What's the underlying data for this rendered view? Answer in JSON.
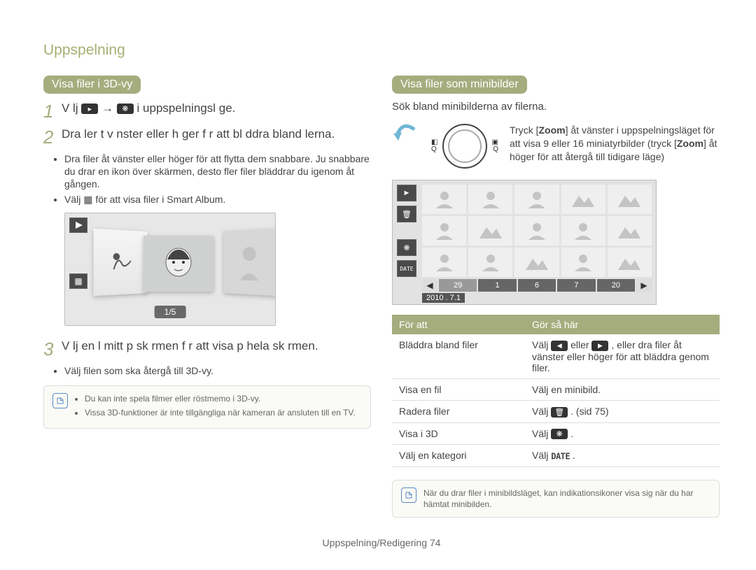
{
  "section_header": "Uppspelning",
  "left": {
    "heading": "Visa filer i 3D-vy",
    "steps": [
      {
        "num": "1",
        "pre": "V lj ",
        "post": " i uppspelningsl ge."
      },
      {
        "num": "2",
        "text": "Dra  ler  t v nster eller h ger f r att bl ddra bland  lerna."
      },
      {
        "num": "3",
        "text": "V lj en  l mitt p  sk rmen f r att visa p  hela sk rmen."
      }
    ],
    "step2_bullets": [
      "Dra filer åt vänster eller höger för att flytta dem snabbare. Ju snabbare du drar en ikon över skärmen, desto fler filer bläddrar du igenom åt gången.",
      "Välj ▦ för att visa filer i Smart Album."
    ],
    "step3_bullets": [
      "Välj filen som ska återgå till 3D-vy."
    ],
    "figure_counter": "1/5",
    "info": {
      "items": [
        "Du kan inte spela filmer eller röstmemo i 3D-vy.",
        "Vissa 3D-funktioner är inte tillgängliga när kameran är ansluten till en TV."
      ]
    }
  },
  "right": {
    "heading": "Visa filer som minibilder",
    "intro": "Sök bland minibilderna av filerna.",
    "zoom": {
      "left_labels": [
        "◧",
        "Q"
      ],
      "right_labels": [
        "▣",
        "Q"
      ],
      "pre": "Tryck [",
      "zoom1": "Zoom",
      "mid": "] åt vänster i uppspelningsläget för att visa 9 eller 16 miniatyrbilder (tryck [",
      "zoom2": "Zoom",
      "post": "] åt höger för att återgå till tidigare läge)"
    },
    "figure": {
      "nav_numbers": [
        "29",
        "1",
        "6",
        "7",
        "20"
      ],
      "date": "2010 . 7.1"
    },
    "table": {
      "headers": [
        "För att",
        "Gör så här"
      ],
      "rows": [
        {
          "label": "Bläddra bland filer",
          "kind": "browse",
          "text": {
            "pre": "Välj ",
            "mid": " eller ",
            "post": ", eller dra filer åt vänster eller höger för att bläddra genom filer."
          }
        },
        {
          "label": "Visa en fil",
          "kind": "plain",
          "action": "Välj en minibild."
        },
        {
          "label": "Radera filer",
          "kind": "trash",
          "text": {
            "pre": "Välj ",
            "post": ". (sid 75)"
          }
        },
        {
          "label": "Visa i 3D",
          "kind": "flower",
          "text": {
            "pre": "Välj ",
            "post": "."
          }
        },
        {
          "label": "Välj en kategori",
          "kind": "date",
          "text": {
            "pre": "Välj ",
            "date": "DATE",
            "post": "."
          }
        }
      ]
    },
    "footnote": "När du drar filer i minibildsläget, kan indikationsikoner visa sig när du har hämtat minibilden."
  },
  "footer": {
    "label": "Uppspelning/Redigering",
    "page": "74"
  }
}
